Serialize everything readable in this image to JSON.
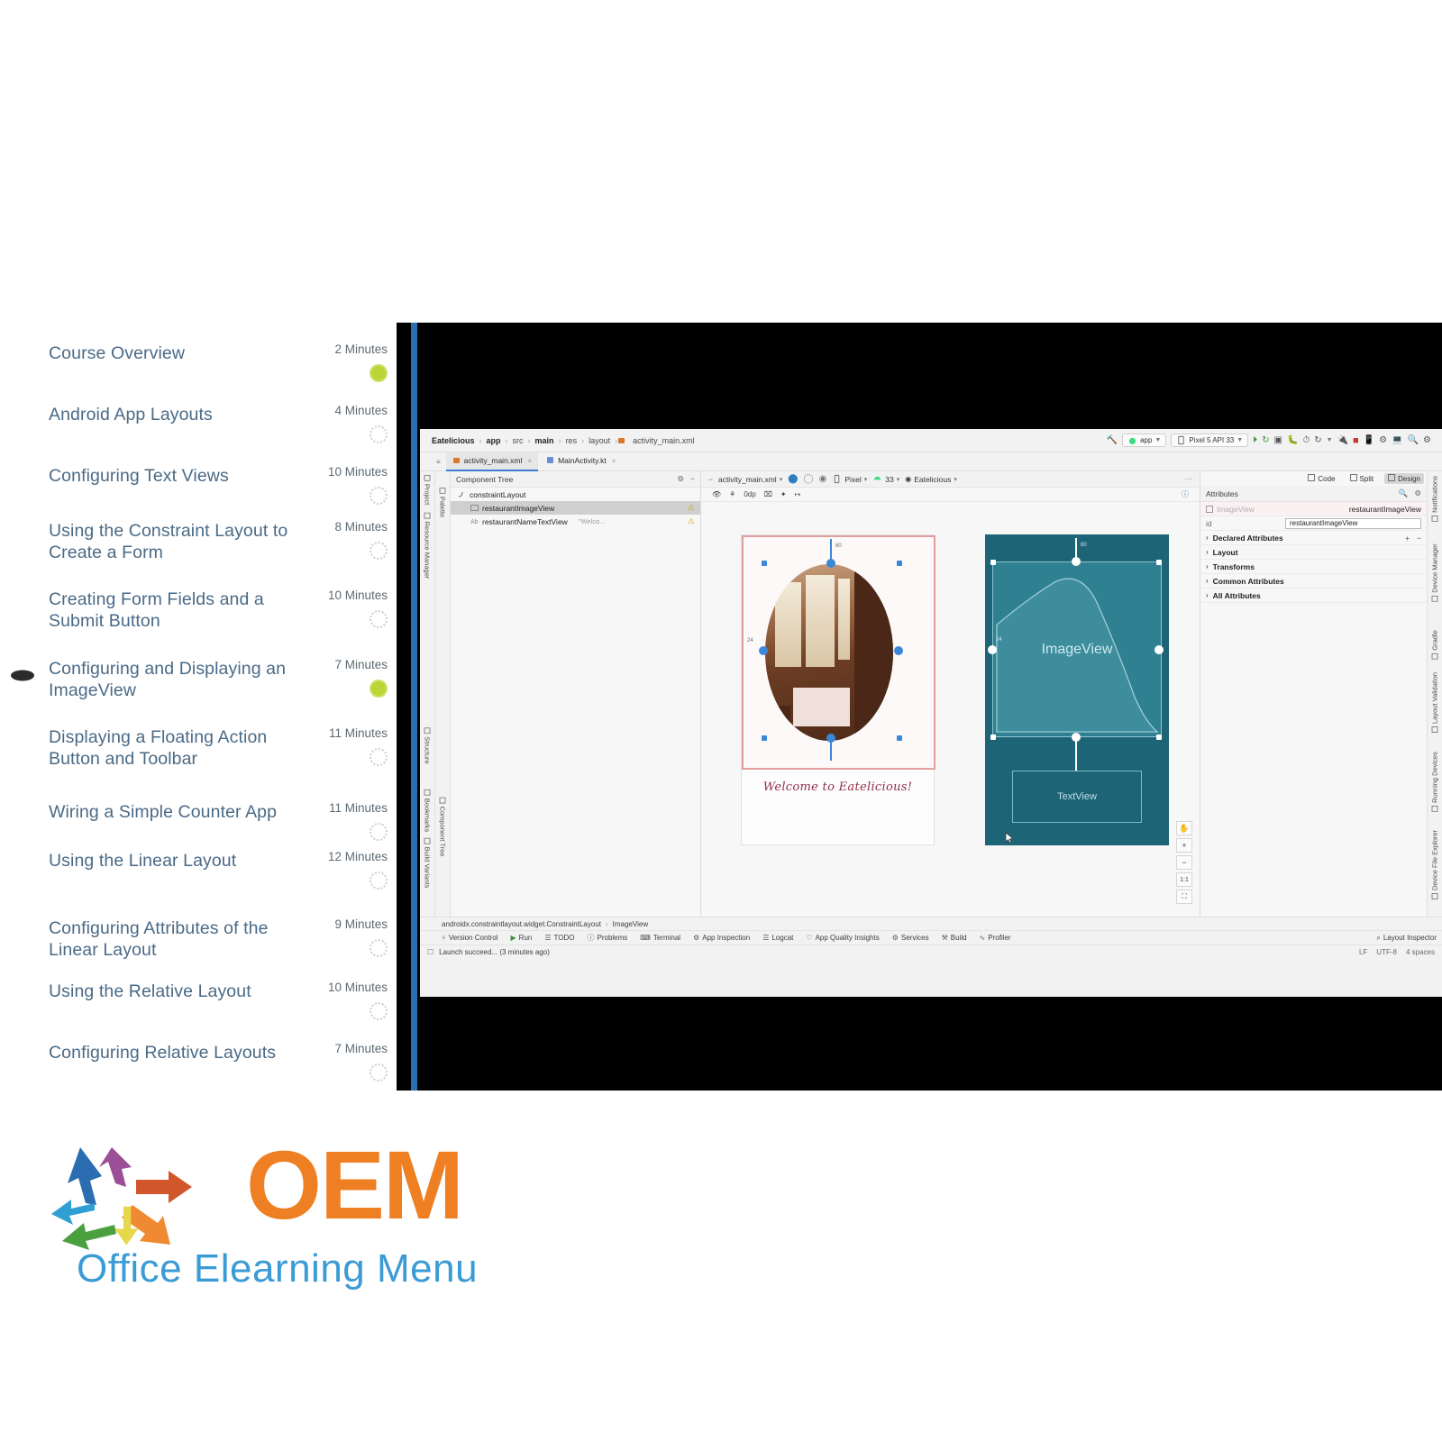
{
  "course": {
    "items": [
      {
        "title": "Course Overview",
        "minutes": "2 Minutes",
        "status": "done"
      },
      {
        "title": "Android App Layouts",
        "minutes": "4 Minutes",
        "status": "todo"
      },
      {
        "title": "Configuring Text Views",
        "minutes": "10 Minutes",
        "status": "todo"
      },
      {
        "title": "Using the Constraint Layout to Create a Form",
        "minutes": "8 Minutes",
        "status": "todo"
      },
      {
        "title": "Creating Form Fields and a Submit Button",
        "minutes": "10 Minutes",
        "status": "todo"
      },
      {
        "title": "Configuring and Displaying an ImageView",
        "minutes": "7 Minutes",
        "status": "done"
      },
      {
        "title": "Displaying a Floating Action Button and Toolbar",
        "minutes": "11 Minutes",
        "status": "todo"
      },
      {
        "title": "Wiring a Simple Counter App",
        "minutes": "11 Minutes",
        "status": "todo"
      },
      {
        "title": "Using the Linear Layout",
        "minutes": "12 Minutes",
        "status": "todo"
      },
      {
        "title": "Configuring Attributes of the Linear Layout",
        "minutes": "9 Minutes",
        "status": "todo"
      },
      {
        "title": "Using the Relative Layout",
        "minutes": "10 Minutes",
        "status": "todo"
      },
      {
        "title": "Configuring Relative Layouts",
        "minutes": "7 Minutes",
        "status": "todo"
      }
    ]
  },
  "ide": {
    "breadcrumb": [
      "Eatelicious",
      "app",
      "src",
      "main",
      "res",
      "layout",
      "activity_main.xml"
    ],
    "run_config": "app",
    "device": "Pixel 5 API 33",
    "tabs": [
      {
        "label": "activity_main.xml",
        "active": true
      },
      {
        "label": "MainActivity.kt",
        "active": false
      }
    ],
    "left_strip": [
      "Project",
      "Resource Manager",
      "Structure",
      "Bookmarks",
      "Build Variants"
    ],
    "left_strip_inner": [
      "Palette",
      "Component Tree"
    ],
    "right_strip": [
      "Notifications",
      "Device Manager",
      "Gradle",
      "Layout Validation",
      "Running Devices",
      "Device File Explorer"
    ],
    "component_tree": {
      "title": "Component Tree",
      "nodes": [
        {
          "label": "constraintLayout",
          "sub": "",
          "indent": false,
          "selected": false,
          "warn": false
        },
        {
          "label": "restaurantImageView",
          "sub": "",
          "indent": true,
          "selected": true,
          "warn": true
        },
        {
          "label": "restaurantNameTextView",
          "sub": "\"Welco...",
          "indent": true,
          "selected": false,
          "warn": true
        }
      ]
    },
    "design_toolbar": {
      "file": "activity_main.xml",
      "device": "Pixel",
      "api": "33",
      "theme": "Eatelicious",
      "dp": "0dp"
    },
    "mode_tabs": [
      {
        "label": "Code",
        "active": false
      },
      {
        "label": "Split",
        "active": false
      },
      {
        "label": "Design",
        "active": true
      }
    ],
    "preview": {
      "welcome_text": "Welcome to Eatelicious!",
      "blueprint_image_label": "ImageView",
      "blueprint_text_label": "TextView",
      "margin_top": "80",
      "margin_side": "24"
    },
    "attributes": {
      "title": "Attributes",
      "widget_type": "ImageView",
      "widget_id_display": "restaurantImageView",
      "id_key": "id",
      "id_value": "restaurantImageView",
      "groups": [
        "Declared Attributes",
        "Layout",
        "Transforms",
        "Common Attributes",
        "All Attributes"
      ]
    },
    "status_path": [
      "androidx.constraintlayout.widget.ConstraintLayout",
      "ImageView"
    ],
    "bottom_tools": [
      "Version Control",
      "Run",
      "TODO",
      "Problems",
      "Terminal",
      "App Inspection",
      "Logcat",
      "App Quality Insights",
      "Services",
      "Build",
      "Profiler"
    ],
    "bottom_tools_right": [
      "Layout Inspector"
    ],
    "status_message": "Launch succeed... (3 minutes ago)",
    "status_right": [
      "LF",
      "UTF-8",
      "4 spaces"
    ],
    "zoom_controls": [
      "+",
      "−",
      "1:1",
      "⛶"
    ]
  },
  "branding": {
    "word": "OEM",
    "tagline": "Office Elearning Menu",
    "accent": "#ee7f22",
    "tagline_color": "#3b9bd6"
  }
}
